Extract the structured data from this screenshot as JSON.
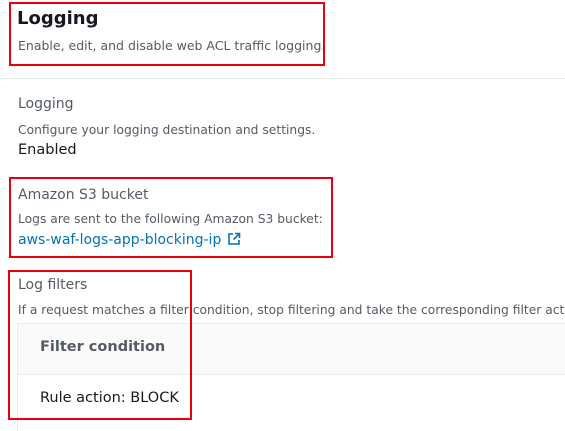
{
  "header": {
    "title": "Logging",
    "subtitle": "Enable, edit, and disable web ACL traffic logging."
  },
  "logging": {
    "label": "Logging",
    "description": "Configure your logging destination and settings.",
    "status": "Enabled"
  },
  "s3": {
    "label": "Amazon S3 bucket",
    "description": "Logs are sent to the following Amazon S3 bucket:",
    "bucket_link": "aws-waf-logs-app-blocking-ip",
    "link_icon": "external-link-icon"
  },
  "log_filters": {
    "label": "Log filters",
    "description": "If a request matches a filter condition, stop filtering and take the corresponding filter actio",
    "table": {
      "header": "Filter condition",
      "rows": [
        "Rule action: BLOCK"
      ]
    }
  },
  "colors": {
    "highlight_box": "#e8000f",
    "link": "#0073bb"
  }
}
